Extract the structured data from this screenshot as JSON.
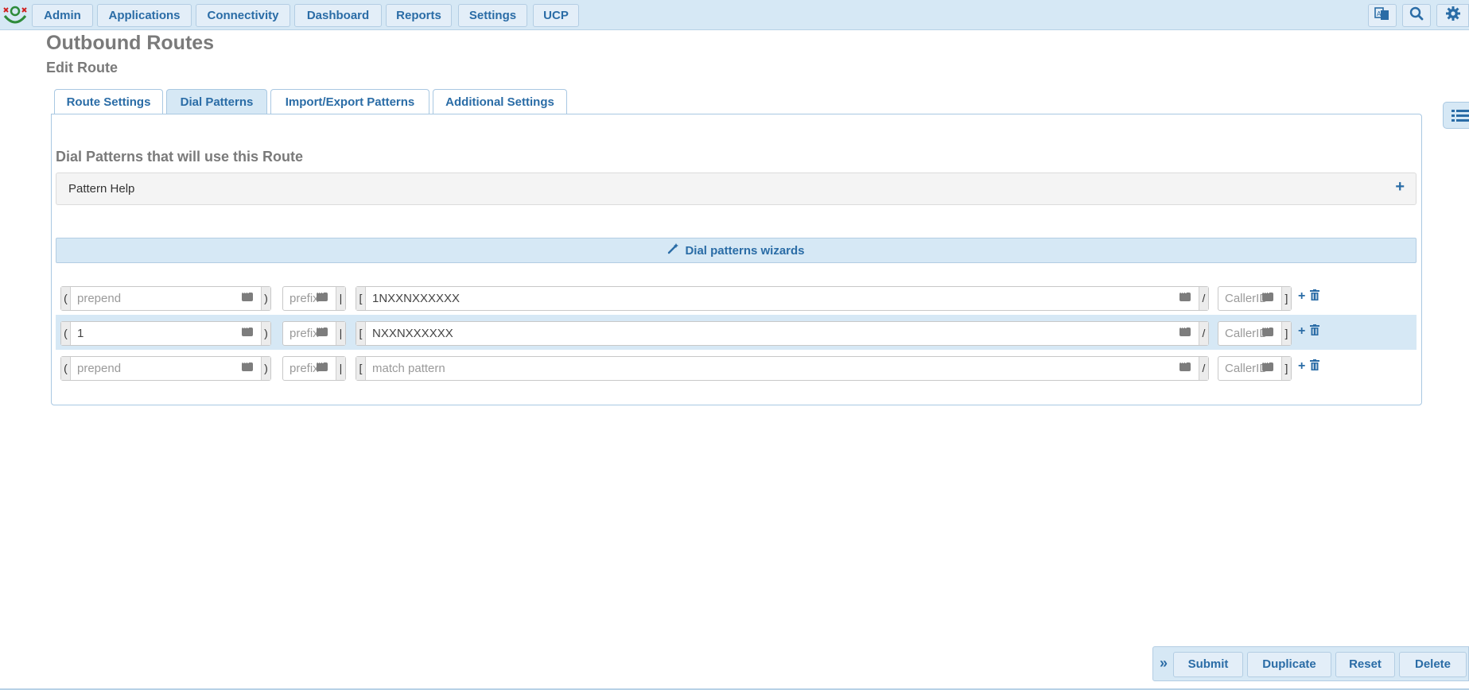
{
  "nav": {
    "items": [
      "Admin",
      "Applications",
      "Connectivity",
      "Dashboard",
      "Reports",
      "Settings",
      "UCP"
    ]
  },
  "header": {
    "title": "Outbound Routes",
    "subtitle": "Edit Route"
  },
  "tabs": [
    {
      "label": "Route Settings",
      "active": false
    },
    {
      "label": "Dial Patterns",
      "active": true
    },
    {
      "label": "Import/Export Patterns",
      "active": false
    },
    {
      "label": "Additional Settings",
      "active": false
    }
  ],
  "section": {
    "heading": "Dial Patterns that will use this Route",
    "help_label": "Pattern Help",
    "help_toggle": "+",
    "wizard_label": "Dial patterns wizards"
  },
  "patterns": [
    {
      "prepend": {
        "value": "",
        "placeholder": "prepend"
      },
      "prefix": {
        "value": "",
        "placeholder": "prefix"
      },
      "match": {
        "value": "1NXXNXXXXXX",
        "placeholder": "match pattern"
      },
      "callerid": {
        "value": "",
        "placeholder": "CallerID"
      }
    },
    {
      "prepend": {
        "value": "1",
        "placeholder": "prepend"
      },
      "prefix": {
        "value": "",
        "placeholder": "prefix"
      },
      "match": {
        "value": "NXXNXXXXXX",
        "placeholder": "match pattern"
      },
      "callerid": {
        "value": "",
        "placeholder": "CallerID"
      }
    },
    {
      "prepend": {
        "value": "",
        "placeholder": "prepend"
      },
      "prefix": {
        "value": "",
        "placeholder": "prefix"
      },
      "match": {
        "value": "",
        "placeholder": "match pattern"
      },
      "callerid": {
        "value": "",
        "placeholder": "CallerID"
      }
    }
  ],
  "brackets": {
    "open_paren": "(",
    "close_paren": ")",
    "pipe": "|",
    "open_sq": "[",
    "slash": "/",
    "close_sq": "]"
  },
  "actions": {
    "collapse": "»",
    "submit": "Submit",
    "duplicate": "Duplicate",
    "reset": "Reset",
    "delete": "Delete"
  },
  "colors": {
    "accent": "#2a6ca6",
    "bar_bg": "#d6e8f5",
    "highlight_row": "#d6e8f5"
  }
}
